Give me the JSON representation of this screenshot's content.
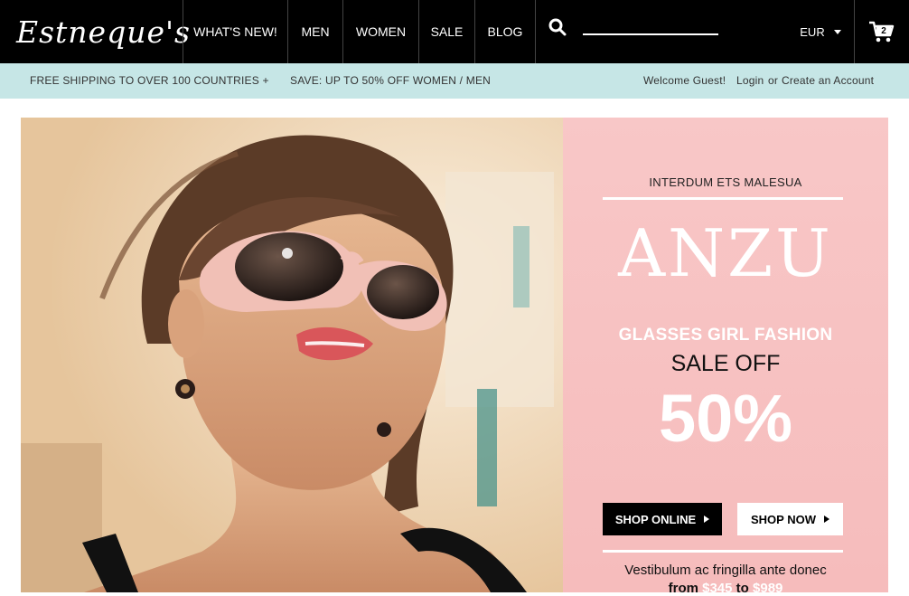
{
  "brand": {
    "logo_text": "Estneque's"
  },
  "nav": {
    "items": [
      {
        "label": "WHAT'S NEW!"
      },
      {
        "label": "MEN"
      },
      {
        "label": "WOMEN"
      },
      {
        "label": "SALE"
      },
      {
        "label": "BLOG"
      }
    ],
    "search": {
      "placeholder": "",
      "icon": "search-icon"
    },
    "currency": "EUR",
    "cart": {
      "icon": "cart-icon",
      "count": "2"
    }
  },
  "infobar": {
    "shipping": "FREE SHIPPING TO OVER 100 COUNTRIES +",
    "save": "SAVE: UP TO 50% OFF WOMEN / MEN",
    "welcome": "Welcome Guest!",
    "login": "Login",
    "or": "or",
    "create_account": "Create an Account"
  },
  "promo": {
    "kicker": "INTERDUM ETS MALESUA",
    "brand": "ANZU",
    "headline": "GLASSES GIRL FASHION",
    "sale_off": "SALE OFF",
    "percent": "50%",
    "shop_online": "SHOP ONLINE",
    "shop_now": "SHOP NOW",
    "description": "Vestibulum ac fringilla ante donec",
    "price_from_label": "from",
    "price_from": "$345",
    "price_to_label": "to",
    "price_to": "$989"
  },
  "colors": {
    "nav_bg": "#000000",
    "infobar_bg": "#c6e6e6",
    "promo_bg": "#f7c2c2",
    "accent_white": "#ffffff"
  }
}
